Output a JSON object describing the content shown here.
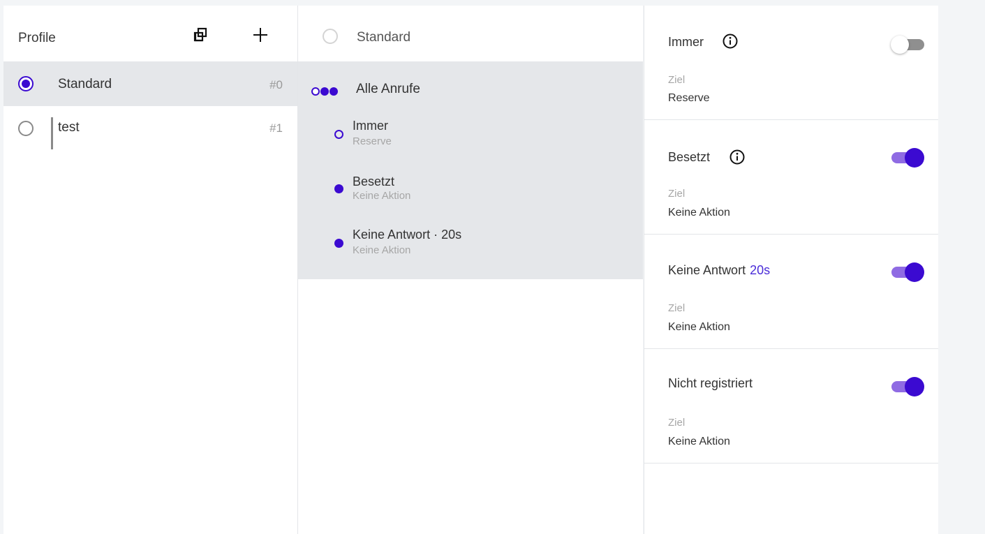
{
  "colors": {
    "accent": "#3b0ad1",
    "accent_light": "#8f6be3",
    "selected_bg": "#e5e7ea",
    "muted_text": "#a6a6a6"
  },
  "profiles": {
    "title": "Profile",
    "duplicate_icon": "duplicate-icon",
    "add_icon": "plus-icon",
    "items": [
      {
        "label": "Standard",
        "number": "#0",
        "selected": true
      },
      {
        "label": "test",
        "number": "#1",
        "selected": false
      }
    ]
  },
  "rules": {
    "header_label": "Standard",
    "all_calls_label": "Alle Anrufe",
    "items": [
      {
        "title": "Immer",
        "subtitle": "Reserve",
        "marker": "hollow"
      },
      {
        "title": "Besetzt",
        "subtitle": "Keine Aktion",
        "marker": "filled"
      },
      {
        "title": "Keine Antwort · 20s",
        "subtitle": "Keine Aktion",
        "marker": "filled"
      }
    ]
  },
  "details": {
    "target_label": "Ziel",
    "cards": [
      {
        "title": "Immer",
        "accent": "",
        "has_info": true,
        "enabled": false,
        "target": "Reserve"
      },
      {
        "title": "Besetzt",
        "accent": "",
        "has_info": true,
        "enabled": true,
        "target": "Keine Aktion"
      },
      {
        "title": "Keine Antwort",
        "accent": "20s",
        "has_info": false,
        "enabled": true,
        "target": "Keine Aktion"
      },
      {
        "title": "Nicht registriert",
        "accent": "",
        "has_info": false,
        "enabled": true,
        "target": "Keine Aktion"
      }
    ]
  }
}
